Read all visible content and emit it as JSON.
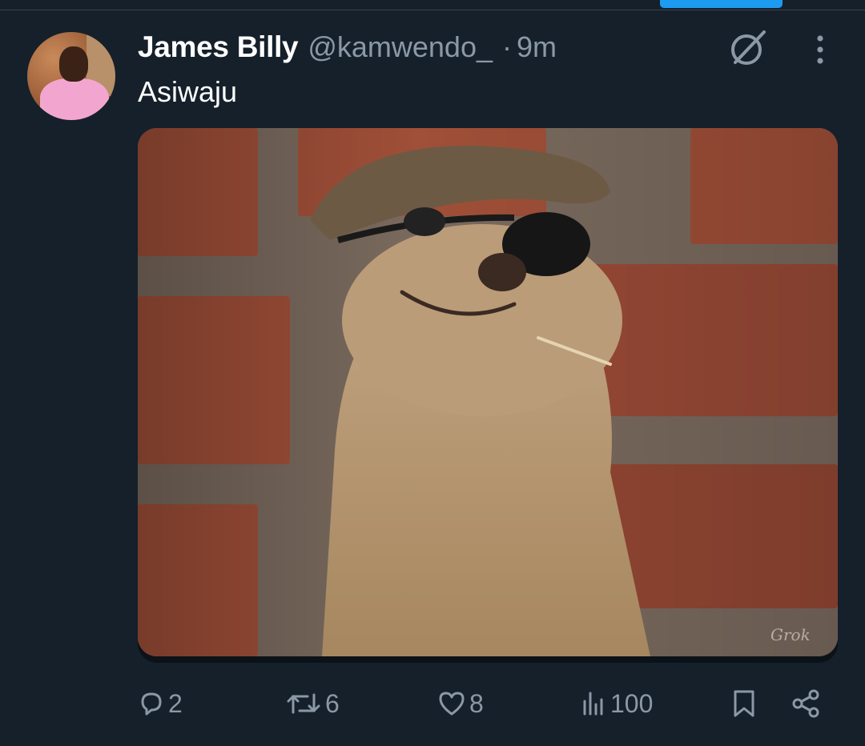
{
  "tweet": {
    "author": {
      "display_name": "James Billy",
      "handle": "@kamwendo_",
      "separator": "·",
      "time": "9m"
    },
    "text": "Asiwaju",
    "media": {
      "watermark": "Grok"
    },
    "stats": {
      "replies": "2",
      "retweets": "6",
      "likes": "8",
      "views": "100"
    }
  },
  "colors": {
    "background": "#15202b",
    "accent": "#1d9bf0",
    "muted_text": "#8b98a5",
    "divider": "#38444d"
  },
  "icons": [
    "grok-icon",
    "more-icon",
    "reply-icon",
    "retweet-icon",
    "like-icon",
    "views-icon",
    "bookmark-icon",
    "share-icon"
  ]
}
